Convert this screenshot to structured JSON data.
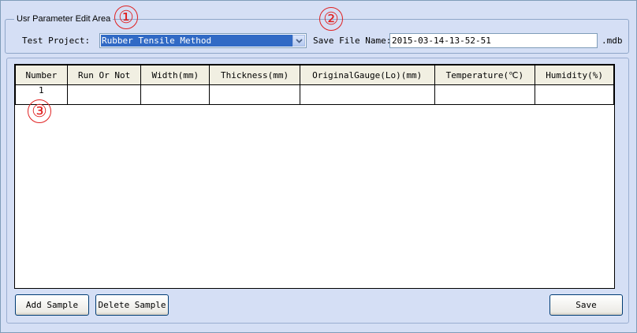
{
  "param_area": {
    "caption": "Usr Parameter Edit Area",
    "test_project_label": "Test Project:",
    "test_project_value": "Rubber Tensile Method",
    "save_file_label": "Save File Name:",
    "save_file_value": "2015-03-14-13-52-51",
    "save_file_ext": ".mdb"
  },
  "table": {
    "columns": [
      "Number",
      "Run Or Not",
      "Width(mm)",
      "Thickness(mm)",
      "OriginalGauge(Lo)(mm)",
      "Temperature(℃)",
      "Humidity(%)"
    ],
    "rows": [
      [
        "1",
        "",
        "",
        "",
        "",
        "",
        ""
      ]
    ]
  },
  "buttons": {
    "add_sample": "Add Sample",
    "delete_sample": "Delete Sample",
    "save": "Save"
  },
  "markers": [
    "①",
    "②",
    "③"
  ],
  "colors": {
    "background": "#d5dff5",
    "selection": "#316ac5",
    "marker": "#e02020",
    "header_bg": "#f1efe2"
  }
}
